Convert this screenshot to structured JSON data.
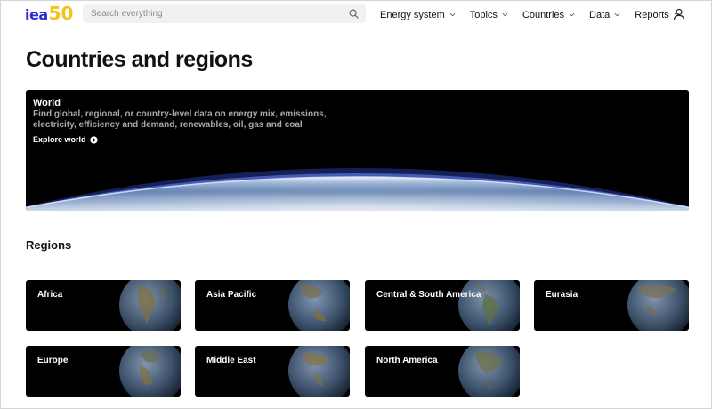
{
  "header": {
    "logo_text": "iea",
    "logo_number": "50",
    "search": {
      "placeholder": "Search everything",
      "value": ""
    },
    "nav": [
      {
        "label": "Energy system"
      },
      {
        "label": "Topics"
      },
      {
        "label": "Countries"
      },
      {
        "label": "Data"
      },
      {
        "label": "Reports"
      }
    ],
    "icons": {
      "search": "search-icon",
      "user": "user-icon",
      "chevron": "chevron-down-icon"
    }
  },
  "page": {
    "title": "Countries and regions"
  },
  "hero": {
    "title": "World",
    "description": "Find global, regional, or country-level data on energy mix, emissions, electricity, efficiency and demand, renewables, oil, gas and coal",
    "link": "Explore world"
  },
  "regions": {
    "heading": "Regions",
    "items": [
      {
        "label": "Africa"
      },
      {
        "label": "Asia Pacific"
      },
      {
        "label": "Central & South America"
      },
      {
        "label": "Eurasia"
      },
      {
        "label": "Europe"
      },
      {
        "label": "Middle East"
      },
      {
        "label": "North America"
      }
    ]
  },
  "colors": {
    "brand_blue": "#2c2bd8",
    "brand_yellow": "#f2c318",
    "card_bg": "#000000"
  }
}
